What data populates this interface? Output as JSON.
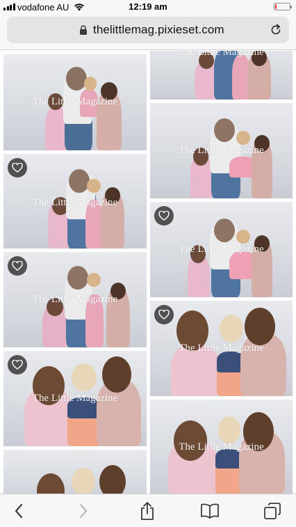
{
  "status_bar": {
    "carrier": "vodafone AU",
    "time": "12:19 am",
    "battery_level": 0.12,
    "battery_color": "#e8352c"
  },
  "url_bar": {
    "url": "thelittlemag.pixieset.com",
    "lock_icon": "lock-icon",
    "reload_icon": "reload-icon"
  },
  "gallery": {
    "watermark": "The Little Magazine",
    "photos": [
      {
        "id": "p1",
        "favorite_button": false
      },
      {
        "id": "p2",
        "favorite_button": false
      },
      {
        "id": "p3",
        "favorite_button": false
      },
      {
        "id": "p4",
        "favorite_button": true
      },
      {
        "id": "p5",
        "favorite_button": true
      },
      {
        "id": "p6",
        "favorite_button": true
      },
      {
        "id": "p7",
        "favorite_button": true
      },
      {
        "id": "p8",
        "favorite_button": true
      },
      {
        "id": "p9",
        "favorite_button": true
      },
      {
        "id": "p10",
        "favorite_button": false
      },
      {
        "id": "p11",
        "favorite_button": false
      }
    ]
  },
  "toolbar": {
    "back_icon": "chevron-left-icon",
    "forward_icon": "chevron-right-icon",
    "share_icon": "share-icon",
    "bookmarks_icon": "book-icon",
    "tabs_icon": "tabs-icon"
  }
}
